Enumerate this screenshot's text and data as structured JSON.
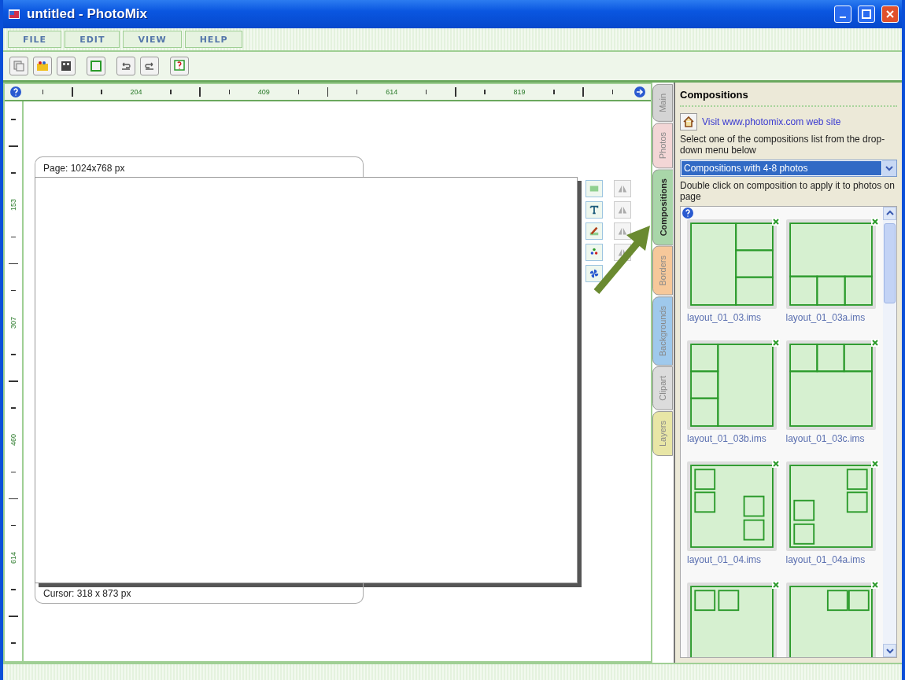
{
  "window": {
    "title": "untitled - PhotoMix"
  },
  "menu": [
    {
      "label": "FILE"
    },
    {
      "label": "EDIT"
    },
    {
      "label": "VIEW"
    },
    {
      "label": "HELP"
    }
  ],
  "ruler_h": {
    "labels": [
      "204",
      "409",
      "614",
      "819"
    ]
  },
  "ruler_v": {
    "labels": [
      "153",
      "307",
      "460",
      "614"
    ]
  },
  "page": {
    "size_label": "Page: 1024x768 px",
    "cursor_label": "Cursor: 318 x 873 px"
  },
  "side_tabs": [
    {
      "label": "Main",
      "selected": false,
      "color": "#d4d4d4"
    },
    {
      "label": "Photos",
      "selected": false,
      "color": "#f3d6d6"
    },
    {
      "label": "Compositions",
      "selected": true,
      "color": "#a9d6a9"
    },
    {
      "label": "Borders",
      "selected": false,
      "color": "#f6c89a"
    },
    {
      "label": "Backgrounds",
      "selected": false,
      "color": "#9fc9ec"
    },
    {
      "label": "Clipart",
      "selected": false,
      "color": "#dcdcdc"
    },
    {
      "label": "Layers",
      "selected": false,
      "color": "#e8e6a6"
    }
  ],
  "panel": {
    "title": "Compositions",
    "link": "Visit www.photomix.com web site",
    "instruction": "Select one of the compositions list from the drop-down menu below",
    "dropdown": {
      "value": "Compositions with 4-8 photos"
    },
    "hint": "Double click on composition to apply it to photos on page",
    "compositions": [
      {
        "name": "layout_01_03.ims"
      },
      {
        "name": "layout_01_03a.ims"
      },
      {
        "name": "layout_01_03b.ims"
      },
      {
        "name": "layout_01_03c.ims"
      },
      {
        "name": "layout_01_04.ims"
      },
      {
        "name": "layout_01_04a.ims"
      }
    ]
  }
}
